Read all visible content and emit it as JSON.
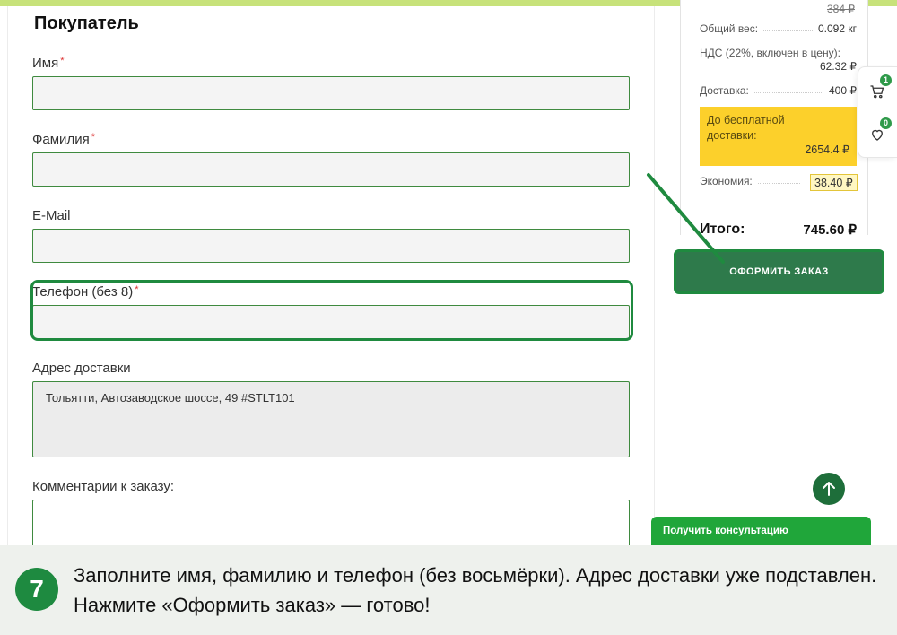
{
  "form": {
    "title": "Покупатель",
    "required_mark": "*",
    "fields": {
      "first_name": {
        "label": "Имя",
        "value": ""
      },
      "last_name": {
        "label": "Фамилия",
        "value": ""
      },
      "email": {
        "label": "E-Mail",
        "value": ""
      },
      "phone": {
        "label": "Телефон (без 8)",
        "value": ""
      },
      "address": {
        "label": "Адрес доставки",
        "value": "Тольятти, Автозаводское шоссе, 49 #STLT101"
      },
      "comment": {
        "label": "Комментарии к заказу:",
        "value": ""
      }
    }
  },
  "summary": {
    "old_price": "384 ₽",
    "weight": {
      "label": "Общий вес:",
      "value": "0.092 кг"
    },
    "vat": {
      "label": "НДС (22%, включен в цену):",
      "value": "62.32 ₽"
    },
    "delivery": {
      "label": "Доставка:",
      "value": "400 ₽"
    },
    "free_delivery": {
      "label": "До бесплатной доставки:",
      "value": "2654.4 ₽"
    },
    "economy": {
      "label": "Экономия:",
      "value": "38.40 ₽"
    },
    "total": {
      "label": "Итого:",
      "value": "745.60 ₽"
    },
    "order_button": "ОФОРМИТЬ ЗАКАЗ"
  },
  "side": {
    "cart_count": "1",
    "wishlist_count": "0",
    "consult_label": "Получить консультацию"
  },
  "caption": {
    "step": "7",
    "text": "Заполните имя, фамилию и телефон (без восьмёрки). Адрес доставки уже подставлен. Нажмите «Оформить заказ» — готово!"
  },
  "colors": {
    "accent_green": "#1f8a3f",
    "button_green": "#2e7a4b",
    "free_delivery_yellow": "#fcd02b",
    "top_strip": "#c7e27a"
  },
  "icons": [
    "cart-icon",
    "heart-icon",
    "arrow-up-icon"
  ]
}
